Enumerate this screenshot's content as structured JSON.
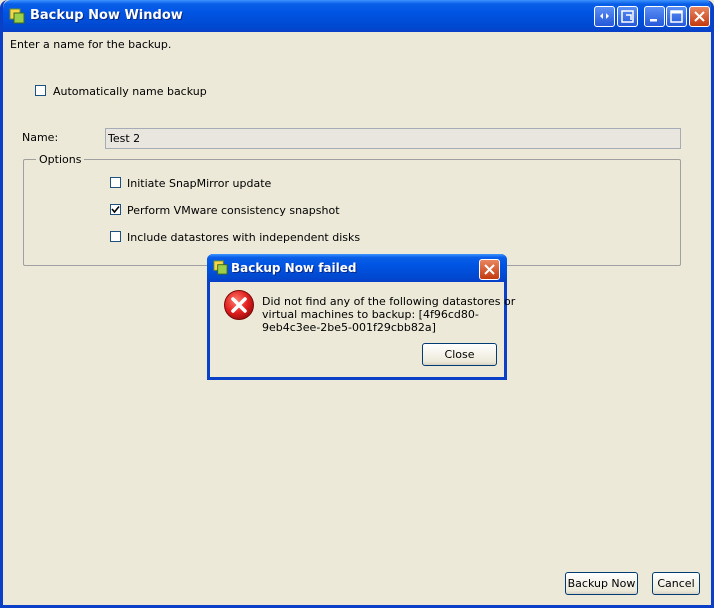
{
  "window": {
    "title": "Backup Now Window"
  },
  "form": {
    "instruction": "Enter a name for the backup.",
    "auto_name_label": "Automatically name backup",
    "auto_name_checked": false,
    "name_label": "Name:",
    "name_value": "Test 2",
    "options_legend": "Options",
    "options": [
      {
        "label": "Initiate SnapMirror update",
        "checked": false
      },
      {
        "label": "Perform VMware consistency snapshot",
        "checked": true
      },
      {
        "label": "Include datastores with independent disks",
        "checked": false
      }
    ]
  },
  "footer": {
    "backup_now_label": "Backup Now",
    "cancel_label": "Cancel"
  },
  "dialog": {
    "title": "Backup Now failed",
    "message_lines": [
      "Did not find any of the following datastores or",
      "virtual machines to backup: [4f96cd80-",
      "9eb4c3ee-2be5-001f29cbb82a]"
    ],
    "close_label": "Close"
  },
  "colors": {
    "titlebar": "#0054e3",
    "window_bg": "#ece9d8",
    "error_red": "#d11a1a"
  }
}
